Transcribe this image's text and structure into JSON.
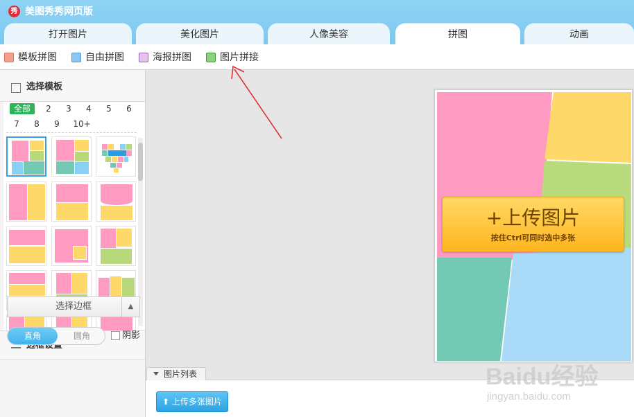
{
  "app": {
    "title": "美图秀秀网页版",
    "logo_text": "秀"
  },
  "tabs": [
    {
      "label": "打开图片"
    },
    {
      "label": "美化图片"
    },
    {
      "label": "人像美容"
    },
    {
      "label": "拼图",
      "active": true
    },
    {
      "label": "动画"
    }
  ],
  "subtoolbar": {
    "items": [
      {
        "label": "模板拼图",
        "icon": "template-collage-icon"
      },
      {
        "label": "自由拼图",
        "icon": "free-collage-icon"
      },
      {
        "label": "海报拼图",
        "icon": "poster-collage-icon"
      },
      {
        "label": "图片拼接",
        "icon": "image-stitch-icon"
      }
    ]
  },
  "template_panel": {
    "title": "选择模板",
    "filters": [
      "全部",
      "2",
      "3",
      "4",
      "5",
      "6",
      "7",
      "8",
      "9",
      "10+"
    ],
    "active_filter": "全部"
  },
  "border_panel": {
    "title": "边框设置",
    "frame_select": "选择边框",
    "corner_options": [
      "直角",
      "圆角"
    ],
    "active_corner": "直角",
    "shadow_label": "阴影",
    "shadow_checked": false
  },
  "canvas": {
    "upload_title": "+上传图片",
    "upload_hint": "按住Ctrl可同时选中多张"
  },
  "image_list": {
    "tab_label": "图片列表",
    "upload_multi_label": "上传多张图片"
  },
  "colors": {
    "pink": "#ff9bc0",
    "yellow": "#ffd86a",
    "green": "#b7d97a",
    "teal": "#74c9b4",
    "blue": "#a9daf7",
    "accent": "#2bb45a",
    "title_bar": "#8fd3f4"
  },
  "watermark": {
    "brand": "Baidu经验",
    "url": "jingyan.baidu.com"
  }
}
